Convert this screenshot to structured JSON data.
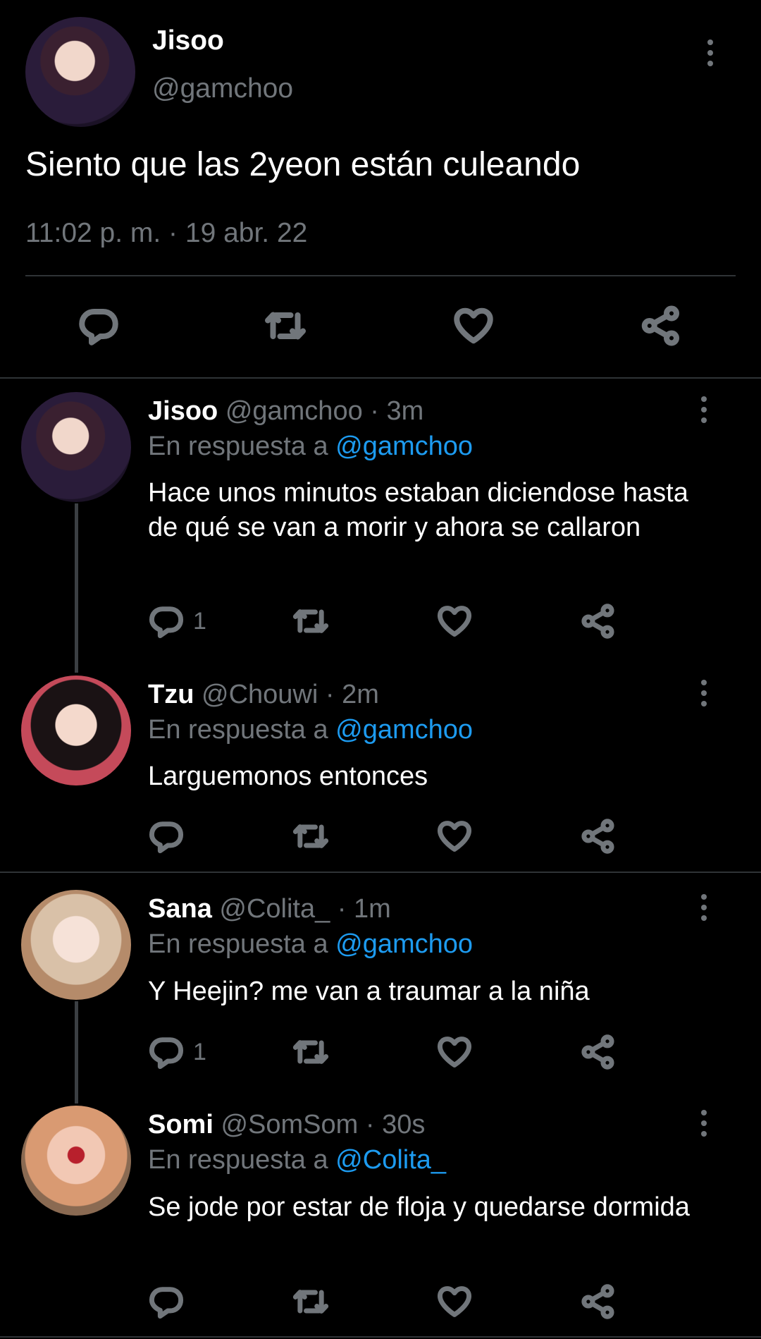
{
  "main_tweet": {
    "display_name": "Jisoo",
    "handle": "@gamchoo",
    "text": "Siento que las 2yeon están culeando",
    "timestamp": "11:02 p. m. · 19 abr. 22",
    "actions": [
      "reply-icon",
      "retweet-icon",
      "like-icon",
      "share-icon"
    ]
  },
  "replies": [
    {
      "display_name": "Jisoo",
      "meta": "@gamchoo · 3m",
      "in_reply_label": "En respuesta a",
      "mention": "@gamchoo",
      "text": "Hace unos minutos estaban diciendose hasta de qué se van a morir y ahora se callaron",
      "reply_count": "1"
    },
    {
      "display_name": "Tzu",
      "meta": "@Chouwi · 2m",
      "in_reply_label": "En respuesta a",
      "mention": "@gamchoo",
      "text": "Larguemonos entonces",
      "reply_count": ""
    },
    {
      "display_name": "Sana",
      "meta": "@Colita_ · 1m",
      "in_reply_label": "En respuesta a",
      "mention": "@gamchoo",
      "text": "Y Heejin? me van a traumar a la niña",
      "reply_count": "1"
    },
    {
      "display_name": "Somi",
      "meta": "@SomSom · 30s",
      "in_reply_label": "En respuesta a",
      "mention": "@Colita_",
      "text": "Se jode por estar de floja y quedarse dormida",
      "reply_count": ""
    }
  ],
  "colors": {
    "background": "#000000",
    "text_primary": "#ffffff",
    "text_secondary": "#71767b",
    "link": "#1d9bf0",
    "divider": "#2f3336"
  }
}
